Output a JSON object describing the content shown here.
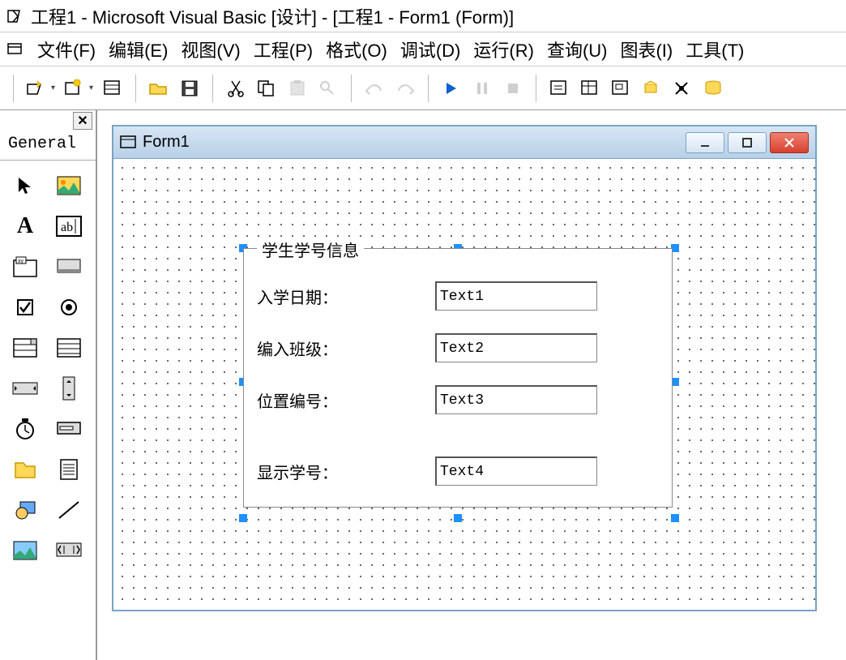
{
  "title": "工程1 - Microsoft Visual Basic [设计] - [工程1 - Form1 (Form)]",
  "menu": {
    "file": "文件(F)",
    "edit": "编辑(E)",
    "view": "视图(V)",
    "project": "工程(P)",
    "format": "格式(O)",
    "debug": "调试(D)",
    "run": "运行(R)",
    "query": "查询(U)",
    "diagram": "图表(I)",
    "tools": "工具(T)"
  },
  "toolbox": {
    "title": "General"
  },
  "form": {
    "title": "Form1",
    "frame_legend": "学生学号信息",
    "rows": [
      {
        "label": "入学日期：",
        "value": "Text1"
      },
      {
        "label": "编入班级：",
        "value": "Text2"
      },
      {
        "label": "位置编号：",
        "value": "Text3"
      },
      {
        "label": "显示学号：",
        "value": "Text4"
      }
    ]
  }
}
